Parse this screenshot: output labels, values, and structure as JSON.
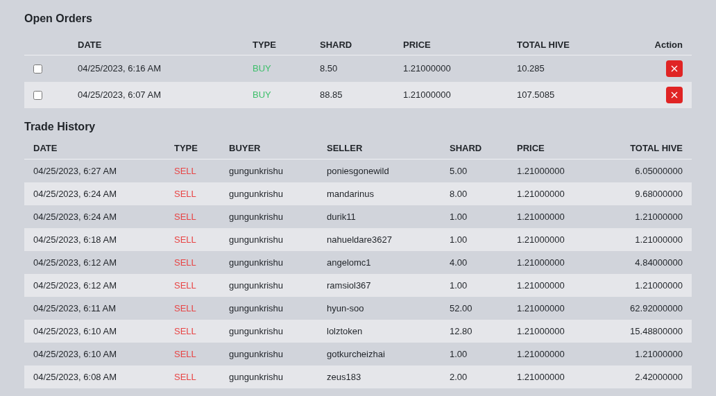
{
  "open_orders": {
    "title": "Open Orders",
    "columns": [
      "DATE",
      "TYPE",
      "SHARD",
      "PRICE",
      "TOTAL HIVE",
      "Action"
    ],
    "rows": [
      {
        "checked": false,
        "date": "04/25/2023, 6:16 AM",
        "type": "BUY",
        "kind": "buy",
        "shard": "8.50",
        "price": "1.21000000",
        "total_hive": "10.285"
      },
      {
        "checked": false,
        "date": "04/25/2023, 6:07 AM",
        "type": "BUY",
        "kind": "buy",
        "shard": "88.85",
        "price": "1.21000000",
        "total_hive": "107.5085"
      }
    ]
  },
  "trade_history": {
    "title": "Trade History",
    "columns": [
      "DATE",
      "TYPE",
      "BUYER",
      "SELLER",
      "SHARD",
      "PRICE",
      "TOTAL HIVE"
    ],
    "rows": [
      {
        "date": "04/25/2023, 6:27 AM",
        "type": "SELL",
        "kind": "sell",
        "buyer": "gungunkrishu",
        "seller": "poniesgonewild",
        "shard": "5.00",
        "price": "1.21000000",
        "total_hive": "6.05000000"
      },
      {
        "date": "04/25/2023, 6:24 AM",
        "type": "SELL",
        "kind": "sell",
        "buyer": "gungunkrishu",
        "seller": "mandarinus",
        "shard": "8.00",
        "price": "1.21000000",
        "total_hive": "9.68000000"
      },
      {
        "date": "04/25/2023, 6:24 AM",
        "type": "SELL",
        "kind": "sell",
        "buyer": "gungunkrishu",
        "seller": "durik11",
        "shard": "1.00",
        "price": "1.21000000",
        "total_hive": "1.21000000"
      },
      {
        "date": "04/25/2023, 6:18 AM",
        "type": "SELL",
        "kind": "sell",
        "buyer": "gungunkrishu",
        "seller": "nahueldare3627",
        "shard": "1.00",
        "price": "1.21000000",
        "total_hive": "1.21000000"
      },
      {
        "date": "04/25/2023, 6:12 AM",
        "type": "SELL",
        "kind": "sell",
        "buyer": "gungunkrishu",
        "seller": "angelomc1",
        "shard": "4.00",
        "price": "1.21000000",
        "total_hive": "4.84000000"
      },
      {
        "date": "04/25/2023, 6:12 AM",
        "type": "SELL",
        "kind": "sell",
        "buyer": "gungunkrishu",
        "seller": "ramsiol367",
        "shard": "1.00",
        "price": "1.21000000",
        "total_hive": "1.21000000"
      },
      {
        "date": "04/25/2023, 6:11 AM",
        "type": "SELL",
        "kind": "sell",
        "buyer": "gungunkrishu",
        "seller": "hyun-soo",
        "shard": "52.00",
        "price": "1.21000000",
        "total_hive": "62.92000000"
      },
      {
        "date": "04/25/2023, 6:10 AM",
        "type": "SELL",
        "kind": "sell",
        "buyer": "gungunkrishu",
        "seller": "lolztoken",
        "shard": "12.80",
        "price": "1.21000000",
        "total_hive": "15.48800000"
      },
      {
        "date": "04/25/2023, 6:10 AM",
        "type": "SELL",
        "kind": "sell",
        "buyer": "gungunkrishu",
        "seller": "gotkurcheizhai",
        "shard": "1.00",
        "price": "1.21000000",
        "total_hive": "1.21000000"
      },
      {
        "date": "04/25/2023, 6:08 AM",
        "type": "SELL",
        "kind": "sell",
        "buyer": "gungunkrishu",
        "seller": "zeus183",
        "shard": "2.00",
        "price": "1.21000000",
        "total_hive": "2.42000000"
      }
    ]
  }
}
